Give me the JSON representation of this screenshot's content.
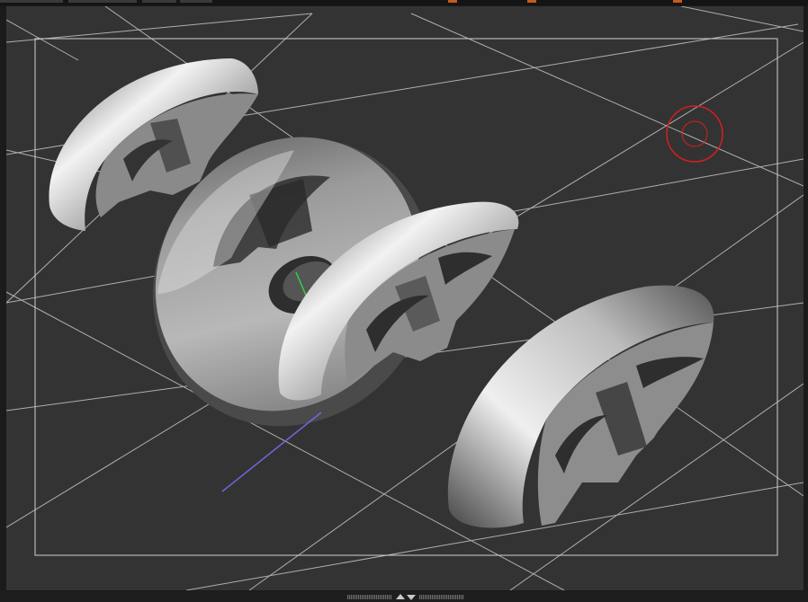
{
  "window": {
    "top_tabs": [
      "",
      "",
      "",
      ""
    ],
    "accent_color": "#c65b1c"
  },
  "viewport": {
    "background": "#333333",
    "grid_color": "#d8d8d8",
    "frame_color": "#d0d0d0",
    "gizmo_color": "#d81e1e",
    "axis_y_color": "#2fd24a",
    "axis_z_color": "#6e68e0",
    "objects": [
      "fender-back-left",
      "fender-disc",
      "fender-middle",
      "fender-front-right"
    ]
  },
  "splitter": {
    "icon": "split-toggle-icon"
  }
}
